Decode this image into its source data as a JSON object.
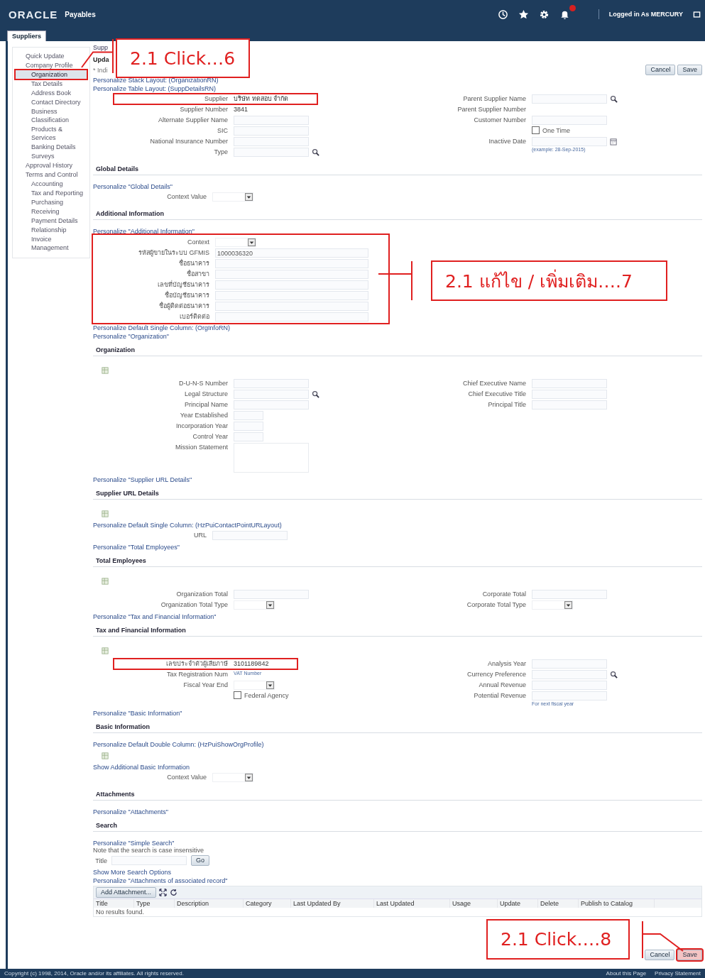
{
  "header": {
    "logo": "ORACLE",
    "app": "Payables",
    "user_label": "Logged in As MERCURY"
  },
  "tab": {
    "label": "Suppliers"
  },
  "sidebar": {
    "items": [
      {
        "label": "Quick Update",
        "selected": false
      },
      {
        "label": "Company Profile",
        "selected": false,
        "children": [
          {
            "label": "Organization",
            "selected": true
          },
          {
            "label": "Tax Details",
            "selected": false
          },
          {
            "label": "Address Book",
            "selected": false
          },
          {
            "label": "Contact Directory",
            "selected": false
          },
          {
            "label": "Business Classification",
            "selected": false
          },
          {
            "label": "Products & Services",
            "selected": false
          },
          {
            "label": "Banking Details",
            "selected": false
          },
          {
            "label": "Surveys",
            "selected": false
          }
        ]
      },
      {
        "label": "Approval History",
        "selected": false
      },
      {
        "label": "Terms and Control",
        "selected": false,
        "children": [
          {
            "label": "Accounting",
            "selected": false
          },
          {
            "label": "Tax and Reporting",
            "selected": false
          },
          {
            "label": "Purchasing",
            "selected": false
          },
          {
            "label": "Receiving",
            "selected": false
          },
          {
            "label": "Payment Details",
            "selected": false
          },
          {
            "label": "Relationship",
            "selected": false
          },
          {
            "label": "Invoice Management",
            "selected": false
          }
        ]
      }
    ]
  },
  "page": {
    "breadcrumb": "Supp",
    "title": "Upda",
    "required_note": "* Indi",
    "buttons": [
      {
        "label": "Cancel",
        "highlighted": false
      },
      {
        "label": "Save",
        "highlighted": false
      }
    ]
  },
  "blocks": [
    {
      "kind": "link",
      "text": "Personalize Stack Layout: (OrganizationRN)"
    },
    {
      "kind": "link",
      "text": "Personalize Table Layout: (SuppDetailsRN)"
    },
    {
      "kind": "form",
      "highlighted": false,
      "columns": [
        [
          {
            "label": "Supplier",
            "value": "บริษัท ทดสอบ จำกัด",
            "kind": "static",
            "highlighted": true
          },
          {
            "label": "Supplier Number",
            "value": "3841",
            "kind": "static",
            "highlighted": false
          },
          {
            "label": "Alternate Supplier Name",
            "kind": "text",
            "highlighted": false
          },
          {
            "label": "SIC",
            "kind": "text",
            "highlighted": false
          },
          {
            "label": "National Insurance Number",
            "kind": "text",
            "highlighted": false
          },
          {
            "label": "Type",
            "kind": "lookup",
            "highlighted": false
          }
        ],
        [
          {
            "label": "Parent Supplier Name",
            "kind": "lookup",
            "highlighted": false
          },
          {
            "label": "Parent Supplier Number",
            "kind": "static",
            "highlighted": false
          },
          {
            "label": "Customer Number",
            "kind": "text",
            "highlighted": false
          },
          {
            "label": "One Time",
            "kind": "checkbox",
            "checked": false,
            "highlighted": false
          },
          {
            "label": "Inactive Date",
            "kind": "date",
            "hint": "(example: 28-Sep-2015)",
            "highlighted": false
          }
        ]
      ]
    },
    {
      "kind": "header",
      "text": "Global Details"
    },
    {
      "kind": "link",
      "text": "Personalize \"Global Details\""
    },
    {
      "kind": "form",
      "highlighted": false,
      "columns": [
        [
          {
            "label": "Context Value",
            "kind": "select",
            "highlighted": false
          }
        ]
      ]
    },
    {
      "kind": "header",
      "text": "Additional Information"
    },
    {
      "kind": "link",
      "text": "Personalize \"Additional Information\""
    },
    {
      "kind": "form",
      "highlighted": true,
      "columns": [
        [
          {
            "label": "Context",
            "kind": "select",
            "highlighted": false
          },
          {
            "label": "รหัสผู้ขายในระบบ GFMIS",
            "value": "1000036320",
            "kind": "text",
            "highlighted": false
          },
          {
            "label": "ชื่อธนาคาร",
            "kind": "text",
            "highlighted": false
          },
          {
            "label": "ชื่อสาขา",
            "kind": "text",
            "highlighted": false
          },
          {
            "label": "เลขที่บัญชีธนาคาร",
            "kind": "text",
            "highlighted": false
          },
          {
            "label": "ชื่อบัญชีธนาคาร",
            "kind": "text",
            "highlighted": false
          },
          {
            "label": "ชื่อผู้ติดต่อธนาคาร",
            "kind": "text",
            "highlighted": false
          },
          {
            "label": "เบอร์ติดต่อ",
            "kind": "text",
            "highlighted": false
          }
        ]
      ]
    },
    {
      "kind": "link",
      "text": "Personalize Default Single Column: (OrgInfoRN)"
    },
    {
      "kind": "link",
      "text": "Personalize \"Organization\""
    },
    {
      "kind": "header",
      "text": "Organization"
    },
    {
      "kind": "icon"
    },
    {
      "kind": "form",
      "highlighted": false,
      "columns": [
        [
          {
            "label": "D-U-N-S Number",
            "kind": "text",
            "highlighted": false
          },
          {
            "label": "Legal Structure",
            "kind": "lookup",
            "highlighted": false
          },
          {
            "label": "Principal Name",
            "kind": "text",
            "highlighted": false
          },
          {
            "label": "Year Established",
            "kind": "short",
            "highlighted": false
          },
          {
            "label": "Incorporation Year",
            "kind": "short",
            "highlighted": false
          },
          {
            "label": "Control Year",
            "kind": "short",
            "highlighted": false
          },
          {
            "label": "Mission Statement",
            "kind": "textarea",
            "highlighted": false
          }
        ],
        [
          {
            "label": "Chief Executive Name",
            "kind": "text",
            "highlighted": false
          },
          {
            "label": "Chief Executive Title",
            "kind": "text",
            "highlighted": false
          },
          {
            "label": "Principal Title",
            "kind": "text",
            "highlighted": false
          }
        ]
      ]
    },
    {
      "kind": "link",
      "text": "Personalize \"Supplier URL Details\""
    },
    {
      "kind": "header",
      "text": "Supplier URL Details"
    },
    {
      "kind": "icon"
    },
    {
      "kind": "link",
      "text": "Personalize Default Single Column: (HzPuiContactPointURLayout)"
    },
    {
      "kind": "form",
      "highlighted": false,
      "columns": [
        [
          {
            "label": "URL",
            "kind": "text",
            "highlighted": false
          }
        ]
      ]
    },
    {
      "kind": "link",
      "text": "Personalize \"Total Employees\""
    },
    {
      "kind": "header",
      "text": "Total Employees"
    },
    {
      "kind": "icon"
    },
    {
      "kind": "form",
      "highlighted": false,
      "columns": [
        [
          {
            "label": "Organization Total",
            "kind": "text",
            "highlighted": false
          },
          {
            "label": "Organization Total Type",
            "kind": "select",
            "highlighted": false
          }
        ],
        [
          {
            "label": "Corporate Total",
            "kind": "text",
            "highlighted": false
          },
          {
            "label": "Corporate Total Type",
            "kind": "select",
            "highlighted": false
          }
        ]
      ]
    },
    {
      "kind": "link",
      "text": "Personalize \"Tax and Financial Information\""
    },
    {
      "kind": "header",
      "text": "Tax and Financial Information"
    },
    {
      "kind": "icon"
    },
    {
      "kind": "form",
      "highlighted": false,
      "columns": [
        [
          {
            "label": "เลขประจำตัวผู้เสียภาษี",
            "value": "3101189842",
            "kind": "static",
            "highlighted": true
          },
          {
            "label": "Tax Registration Num",
            "kind": "static",
            "hint": "VAT Number",
            "highlighted": false
          },
          {
            "label": "Fiscal Year End",
            "kind": "select",
            "highlighted": false
          },
          {
            "label": "Federal Agency",
            "kind": "checkbox",
            "checked": false,
            "highlighted": false
          }
        ],
        [
          {
            "label": "Analysis Year",
            "kind": "text",
            "highlighted": false
          },
          {
            "label": "Currency Preference",
            "kind": "lookup",
            "highlighted": false
          },
          {
            "label": "Annual Revenue",
            "kind": "text",
            "highlighted": false
          },
          {
            "label": "Potential Revenue",
            "kind": "text",
            "hint": "For next fiscal year",
            "highlighted": false
          }
        ]
      ]
    },
    {
      "kind": "link",
      "text": "Personalize \"Basic Information\""
    },
    {
      "kind": "header",
      "text": "Basic Information"
    },
    {
      "kind": "link",
      "text": "Personalize Default Double Column: (HzPuiShowOrgProfile)"
    },
    {
      "kind": "icon"
    },
    {
      "kind": "link",
      "text": "Show Additional Basic Information"
    },
    {
      "kind": "form",
      "highlighted": false,
      "columns": [
        [
          {
            "label": "Context Value",
            "kind": "select",
            "highlighted": false
          }
        ]
      ]
    },
    {
      "kind": "header",
      "text": "Attachments"
    },
    {
      "kind": "link",
      "text": "Personalize \"Attachments\""
    },
    {
      "kind": "header",
      "text": "Search"
    },
    {
      "kind": "link",
      "text": "Personalize \"Simple Search\""
    },
    {
      "kind": "text",
      "text": "Note that the search is case insensitive"
    },
    {
      "kind": "search",
      "label": "Title",
      "button": "Go"
    },
    {
      "kind": "link",
      "text": "Show More Search Options"
    },
    {
      "kind": "link",
      "text": "Personalize \"Attachments of associated record\""
    },
    {
      "kind": "table",
      "button": "Add Attachment...",
      "columns": [
        "Title",
        "Type",
        "Description",
        "Category",
        "Last Updated By",
        "Last Updated",
        "Usage",
        "Update",
        "Delete",
        "Publish to Catalog"
      ],
      "empty": "No results found."
    },
    {
      "kind": "buttons",
      "buttons": [
        {
          "label": "Cancel",
          "highlighted": false
        },
        {
          "label": "Save",
          "highlighted": true
        }
      ]
    }
  ],
  "annotations": [
    {
      "text": "2.1 Click…6"
    },
    {
      "text": "2.1 แก้ไข / เพิ่มเติม….7"
    },
    {
      "text": "2.1 Click….8"
    }
  ],
  "footer": {
    "copyright": "Copyright (c) 1998, 2014, Oracle and/or its affiliates. All rights reserved.",
    "links": [
      "About this Page",
      "Privacy Statement"
    ]
  }
}
